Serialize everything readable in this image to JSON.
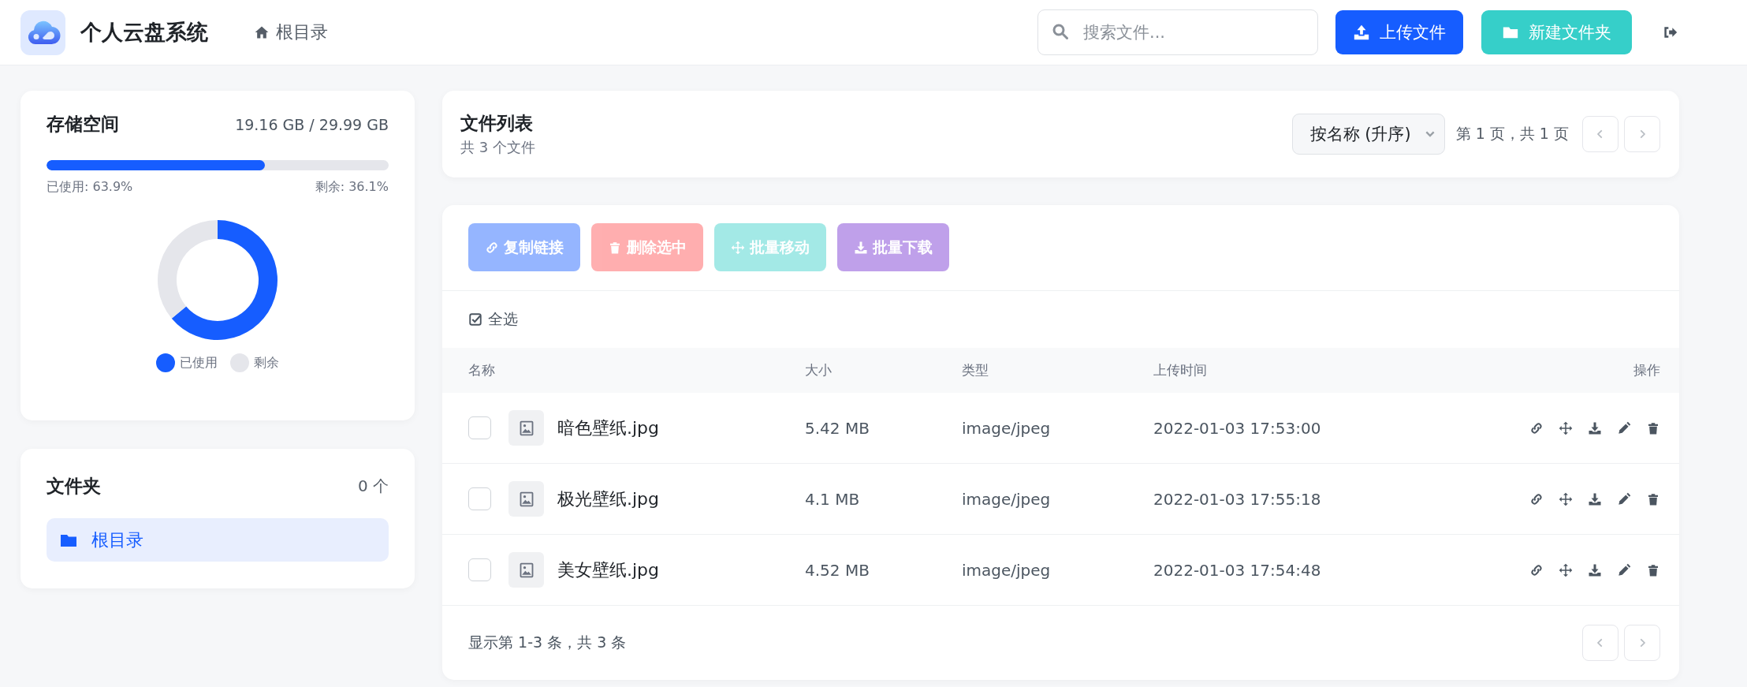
{
  "header": {
    "app_title": "个人云盘系统",
    "breadcrumb": "根目录",
    "search": {
      "placeholder": "搜索文件..."
    },
    "buttons": [
      {
        "label": "上传文件",
        "kind": "upload"
      },
      {
        "label": "新建文件夹",
        "kind": "folder"
      }
    ]
  },
  "storage": {
    "title": "存储空间",
    "usage": "19.16 GB / 29.99 GB",
    "level": 0.639,
    "used_label": "已使用: 63.9%",
    "free_label": "剩余: 36.1%",
    "chart_data": {
      "type": "donut",
      "categories": [
        "已使用",
        "剩余"
      ],
      "values": [
        63.9,
        36.1
      ]
    }
  },
  "folders": {
    "title": "文件夹",
    "count": "0 个",
    "items": [
      {
        "label": "根目录",
        "selected": true
      }
    ]
  },
  "file_list": {
    "title": "文件列表",
    "subtitle": "共 3 个文件",
    "sort": "按名称 (升序)",
    "page_info": "第 1 页，共 1 页"
  },
  "bulk_actions": [
    {
      "label": "复制链接",
      "kind": "link",
      "disabled": true
    },
    {
      "label": "删除选中",
      "kind": "delete",
      "disabled": true
    },
    {
      "label": "批量移动",
      "kind": "move",
      "disabled": true
    },
    {
      "label": "批量下载",
      "kind": "download",
      "disabled": true
    }
  ],
  "select_all": "全选",
  "table": {
    "columns": [
      "名称",
      "大小",
      "类型",
      "上传时间",
      "操作"
    ],
    "rows": [
      {
        "name": "暗色壁纸.jpg",
        "size": "5.42 MB",
        "type": "image/jpeg",
        "uploaded": "2022-01-03 17:53:00",
        "checked": false
      },
      {
        "name": "极光壁纸.jpg",
        "size": "4.1 MB",
        "type": "image/jpeg",
        "uploaded": "2022-01-03 17:55:18",
        "checked": false
      },
      {
        "name": "美女壁纸.jpg",
        "size": "4.52 MB",
        "type": "image/jpeg",
        "uploaded": "2022-01-03 17:54:48",
        "checked": false
      }
    ]
  },
  "footer": {
    "summary": "显示第 1-3 条，共 3 条"
  }
}
